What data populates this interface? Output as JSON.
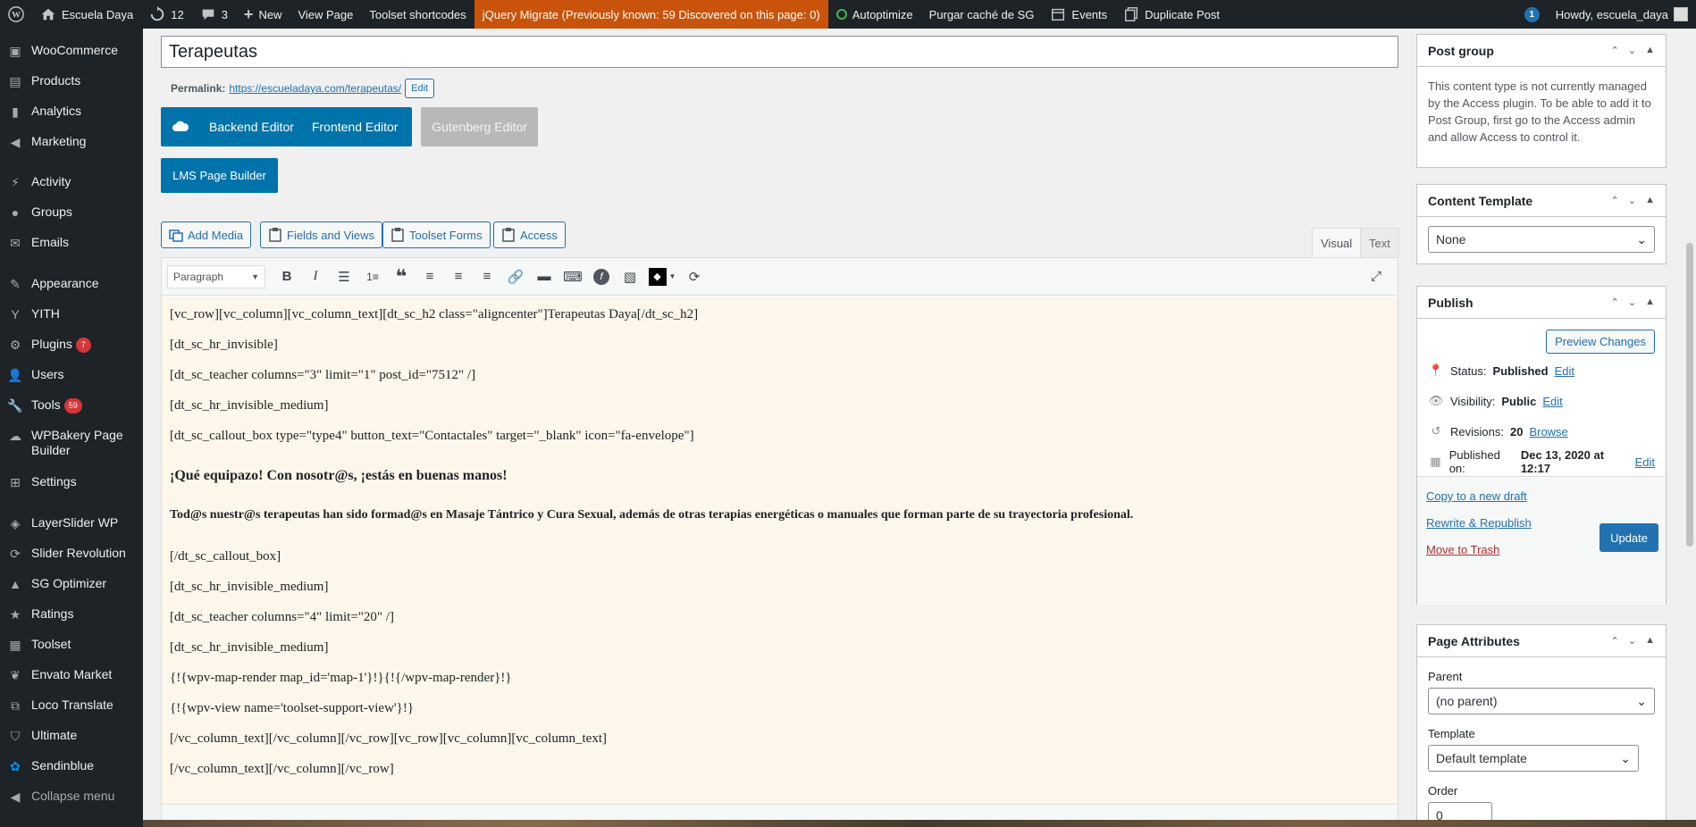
{
  "admin_bar": {
    "site_name": "Escuela Daya",
    "updates_count": "12",
    "comments_count": "3",
    "new_label": "New",
    "view_page": "View Page",
    "toolset_shortcodes": "Toolset shortcodes",
    "jquery_migrate": "jQuery Migrate (Previously known: 59 Discovered on this page: 0)",
    "autoptimize": "Autoptimize",
    "purgar": "Purgar caché de SG",
    "events": "Events",
    "duplicate": "Duplicate Post",
    "notif_count": "1",
    "howdy": "Howdy, escuela_daya",
    "highlight_color": "#c9530a"
  },
  "sidebar": {
    "items": [
      {
        "label": "WooCommerce",
        "icon": "woocommerce-icon"
      },
      {
        "label": "Products",
        "icon": "products-icon"
      },
      {
        "label": "Analytics",
        "icon": "analytics-icon"
      },
      {
        "label": "Marketing",
        "icon": "marketing-icon"
      },
      {
        "label": "Activity",
        "icon": "activity-icon"
      },
      {
        "label": "Groups",
        "icon": "groups-icon"
      },
      {
        "label": "Emails",
        "icon": "emails-icon"
      },
      {
        "label": "Appearance",
        "icon": "appearance-icon"
      },
      {
        "label": "YITH",
        "icon": "yith-icon"
      },
      {
        "label": "Plugins",
        "icon": "plugins-icon",
        "count": "7"
      },
      {
        "label": "Users",
        "icon": "users-icon"
      },
      {
        "label": "Tools",
        "icon": "tools-icon",
        "count": "59"
      },
      {
        "label": "WPBakery Page Builder",
        "icon": "wpbakery-icon"
      },
      {
        "label": "Settings",
        "icon": "settings-icon"
      },
      {
        "label": "LayerSlider WP",
        "icon": "layerslider-icon"
      },
      {
        "label": "Slider Revolution",
        "icon": "slider-revolution-icon"
      },
      {
        "label": "SG Optimizer",
        "icon": "sg-optimizer-icon"
      },
      {
        "label": "Ratings",
        "icon": "star-icon"
      },
      {
        "label": "Toolset",
        "icon": "toolset-icon"
      },
      {
        "label": "Envato Market",
        "icon": "envato-icon"
      },
      {
        "label": "Loco Translate",
        "icon": "loco-icon"
      },
      {
        "label": "Ultimate",
        "icon": "ultimate-icon"
      },
      {
        "label": "Sendinblue",
        "icon": "sendinblue-icon"
      },
      {
        "label": "Collapse menu",
        "icon": "collapse-icon"
      }
    ]
  },
  "editor": {
    "title": "Terapeutas",
    "permalink_label": "Permalink:",
    "permalink_url": "https://escueladaya.com/terapeutas/",
    "permalink_edit": "Edit",
    "backend_editor": "Backend Editor",
    "frontend_editor": "Frontend Editor",
    "gutenberg_editor": "Gutenberg Editor",
    "lms_builder": "LMS Page Builder",
    "add_media": "Add Media",
    "fields_views": "Fields and Views",
    "toolset_forms": "Toolset Forms",
    "access": "Access",
    "tab_visual": "Visual",
    "tab_text": "Text",
    "format_select": "Paragraph",
    "lines": [
      "[vc_row][vc_column][vc_column_text][dt_sc_h2 class=\"aligncenter\"]Terapeutas Daya[/dt_sc_h2]",
      "[dt_sc_hr_invisible]",
      "[dt_sc_teacher columns=\"3\" limit=\"1\" post_id=\"7512\" /]",
      "[dt_sc_hr_invisible_medium]",
      "[dt_sc_callout_box type=\"type4\" button_text=\"Contactales\" target=\"_blank\" icon=\"fa-envelope\"]",
      "¡Qué equipazo!  Con nosotr@s, ¡estás en buenas manos!",
      "Tod@s nuestr@s terapeutas han sido formad@s en Masaje Tántrico y Cura Sexual, además de otras terapias energéticas o manuales que forman parte de su trayectoria profesional.",
      "[/dt_sc_callout_box]",
      "[dt_sc_hr_invisible_medium]",
      "[dt_sc_teacher columns=\"4\" limit=\"20\" /]",
      "[dt_sc_hr_invisible_medium]",
      "{!{wpv-map-render map_id='map-1'}!}{!{/wpv-map-render}!}",
      "{!{wpv-view name='toolset-support-view'}!}",
      "[/vc_column_text][/vc_column][/vc_row][vc_row][vc_column][vc_column_text]",
      "[/vc_column_text][/vc_column][/vc_row]"
    ]
  },
  "right": {
    "post_group": {
      "title": "Post group",
      "text": "This content type is not currently managed by the Access plugin. To be able to add it to Post Group, first go to the Access admin and allow Access to control it."
    },
    "content_template": {
      "title": "Content Template",
      "selected": "None"
    },
    "publish": {
      "title": "Publish",
      "preview": "Preview Changes",
      "status_label": "Status:",
      "status_value": "Published",
      "visibility_label": "Visibility:",
      "visibility_value": "Public",
      "revisions_label": "Revisions:",
      "revisions_value": "20",
      "browse": "Browse",
      "published_label": "Published on:",
      "published_value": "Dec 13, 2020 at 12:17",
      "edit": "Edit",
      "copy_draft": "Copy to a new draft",
      "rewrite": "Rewrite & Republish",
      "trash": "Move to Trash",
      "update": "Update"
    },
    "page_attributes": {
      "title": "Page Attributes",
      "parent_label": "Parent",
      "parent_value": "(no parent)",
      "template_label": "Template",
      "template_value": "Default template",
      "order_label": "Order",
      "order_value": "0"
    }
  }
}
